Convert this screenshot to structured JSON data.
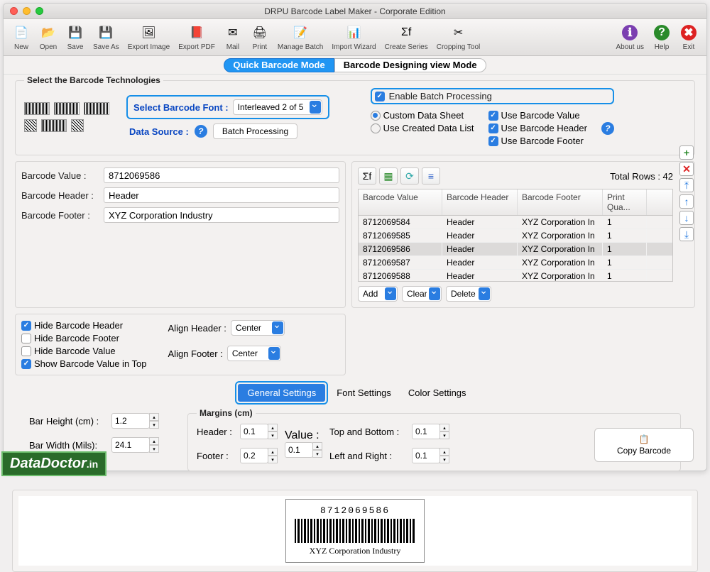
{
  "window_title": "DRPU Barcode Label Maker - Corporate Edition",
  "toolbar": [
    {
      "label": "New",
      "icon": "file-new-icon"
    },
    {
      "label": "Open",
      "icon": "folder-open-icon"
    },
    {
      "label": "Save",
      "icon": "save-icon"
    },
    {
      "label": "Save As",
      "icon": "save-as-icon"
    },
    {
      "label": "Export Image",
      "icon": "export-image-icon"
    },
    {
      "label": "Export PDF",
      "icon": "export-pdf-icon"
    },
    {
      "label": "Mail",
      "icon": "mail-icon"
    },
    {
      "label": "Print",
      "icon": "print-icon"
    },
    {
      "label": "Manage Batch",
      "icon": "batch-icon"
    },
    {
      "label": "Import Wizard",
      "icon": "import-icon"
    },
    {
      "label": "Create Series",
      "icon": "series-icon"
    },
    {
      "label": "Cropping Tool",
      "icon": "crop-icon"
    }
  ],
  "toolbar_right": [
    {
      "label": "About us",
      "icon": "about-icon"
    },
    {
      "label": "Help",
      "icon": "help-icon"
    },
    {
      "label": "Exit",
      "icon": "exit-icon"
    }
  ],
  "modes": {
    "quick": "Quick Barcode Mode",
    "design": "Barcode Designing view Mode"
  },
  "tech": {
    "title": "Select the Barcode Technologies",
    "font_label": "Select Barcode Font :",
    "font_value": "Interleaved 2 of 5",
    "ds_label": "Data Source :",
    "ds_value": "Batch Processing"
  },
  "batch": {
    "enable": "Enable Batch Processing",
    "custom": "Custom Data Sheet",
    "created": "Use Created Data List",
    "use_val": "Use Barcode Value",
    "use_head": "Use Barcode Header",
    "use_foot": "Use Barcode Footer"
  },
  "fields": {
    "value_label": "Barcode Value :",
    "value": "8712069586",
    "header_label": "Barcode Header :",
    "header": "Header",
    "footer_label": "Barcode Footer :",
    "footer": "XYZ Corporation Industry"
  },
  "grid": {
    "total_label": "Total Rows : 42",
    "columns": [
      "Barcode Value",
      "Barcode Header",
      "Barcode Footer",
      "Print Qua..."
    ],
    "rows": [
      {
        "v": "8712069584",
        "h": "Header",
        "f": "XYZ Corporation In",
        "q": "1"
      },
      {
        "v": "8712069585",
        "h": "Header",
        "f": "XYZ Corporation In",
        "q": "1"
      },
      {
        "v": "8712069586",
        "h": "Header",
        "f": "XYZ Corporation In",
        "q": "1"
      },
      {
        "v": "8712069587",
        "h": "Header",
        "f": "XYZ Corporation In",
        "q": "1"
      },
      {
        "v": "8712069588",
        "h": "Header",
        "f": "XYZ Corporation In",
        "q": "1"
      }
    ],
    "add": "Add",
    "clear": "Clear",
    "delete": "Delete"
  },
  "opts": {
    "hide_header": "Hide Barcode Header",
    "hide_footer": "Hide Barcode Footer",
    "hide_value": "Hide Barcode Value",
    "show_top": "Show Barcode Value in Top",
    "align_header": "Align Header :",
    "align_footer": "Align Footer :",
    "center": "Center"
  },
  "tabs": {
    "general": "General Settings",
    "font": "Font Settings",
    "color": "Color Settings"
  },
  "settings": {
    "bar_height_label": "Bar Height (cm) :",
    "bar_height": "1.2",
    "bar_width_label": "Bar Width (Mils):",
    "bar_width": "24.1",
    "margins_title": "Margins (cm)",
    "m_header_label": "Header :",
    "m_header": "0.1",
    "m_footer_label": "Footer :",
    "m_footer": "0.2",
    "m_value_label": "Value :",
    "m_value": "0.1",
    "m_tb_label": "Top and Bottom :",
    "m_tb": "0.1",
    "m_lr_label": "Left and Right :",
    "m_lr": "0.1"
  },
  "preview": {
    "value": "8712069586",
    "footer": "XYZ Corporation Industry"
  },
  "copy_label": "Copy Barcode",
  "watermark": {
    "a": "DataDoctor",
    "b": ".in"
  }
}
